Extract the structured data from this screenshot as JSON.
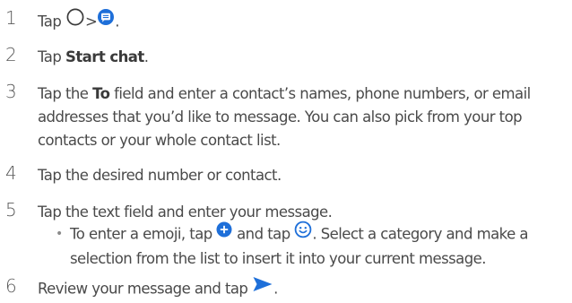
{
  "steps": [
    {
      "num": "1",
      "tap": "Tap",
      "gt": ">",
      "dot": "."
    },
    {
      "num": "2",
      "pre": "Tap ",
      "bold": "Start chat",
      "post": "."
    },
    {
      "num": "3",
      "pre": "Tap the ",
      "bold": "To",
      "post": " field and enter a contact’s names, phone numbers, or email addresses that you’d like to message. You can also pick from your top contacts or your whole contact list."
    },
    {
      "num": "4",
      "text": "Tap the desired number or contact."
    },
    {
      "num": "5",
      "text": "Tap the text field and enter your message."
    },
    {
      "num": "6",
      "text": "Review your message and tap",
      "dot": "."
    }
  ],
  "sub_bullet": {
    "bullet": "•",
    "part1": "To enter a emoji, tap",
    "part2": "and tap",
    "part3": ". Select a category and make a selection from the list to insert it into your current message."
  },
  "icons": {
    "home": "home-circle-icon",
    "messages": "messages-app-icon",
    "add": "add-plus-icon",
    "emoji": "emoji-smiley-icon",
    "send": "send-arrow-icon"
  },
  "colors": {
    "text": "#4a4a4a",
    "accent": "#1e6fd9"
  }
}
